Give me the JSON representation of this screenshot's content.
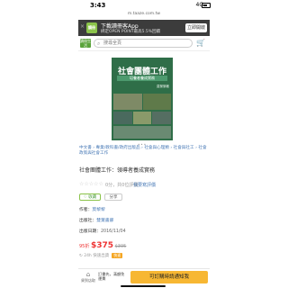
{
  "status": {
    "time": "3:43",
    "network": "4G",
    "url": "m.taaze.com.tw"
  },
  "app_banner": {
    "close": "×",
    "logo": "讀冊",
    "title": "下載讀冊客App",
    "subtitle": "綁定OPEN POINT最高5.5%回饋",
    "button": "立即開啟"
  },
  "nav": {
    "logo": "讀冊生活",
    "search_placeholder": "搜尋全頁",
    "cart_icon": "shopping-cart"
  },
  "cover": {
    "title": "社會團體工作",
    "subtitle": "培養者養成實務",
    "author": "莫黎黎著"
  },
  "carousel_dots": "•••",
  "breadcrumb": "中文書 › 專業/教科書/政府出版品 › 社會與心理類 › 社會與社工 › 社會政策與社會工作",
  "book_title": "社會團體工作：領導者養成實務",
  "rating": {
    "stars": "☆☆☆☆☆",
    "count_text": "0分，共0位評價",
    "review_link": "我要寫評價"
  },
  "actions": {
    "favorite": "♡ 收藏",
    "share": "分享"
  },
  "meta": {
    "author_label": "作者：",
    "author": "莫黎黎",
    "publisher_label": "出版社：",
    "publisher": "雙葉書廊",
    "date_label": "出版日期：",
    "date": "2016/11/04"
  },
  "price": {
    "discount": "95折",
    "amount": "$375",
    "original": "$395"
  },
  "delivery": {
    "text": "↻ 24h 快速出貨",
    "tag": "快速"
  },
  "bottom_bar": {
    "icon_label": "貨到店取",
    "store_text": "訂書先，滿額免運費",
    "cta": "可訂購時請通知我"
  }
}
